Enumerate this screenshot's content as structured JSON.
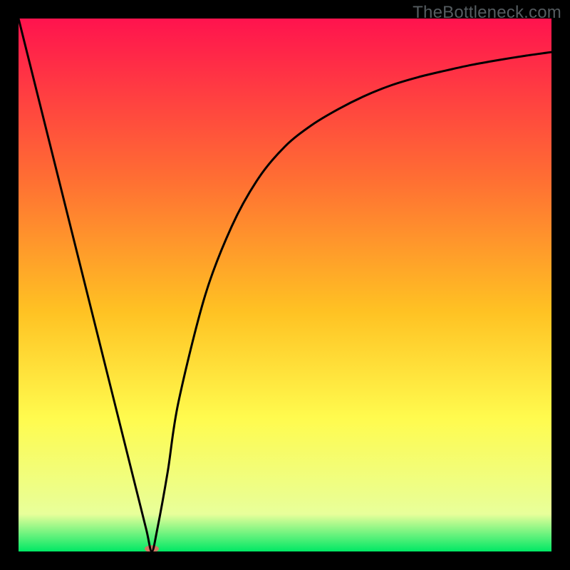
{
  "watermark": "TheBottleneck.com",
  "chart_data": {
    "type": "line",
    "title": "",
    "xlabel": "",
    "ylabel": "",
    "xlim": [
      0,
      100
    ],
    "ylim": [
      0,
      100
    ],
    "gradient_stops": [
      {
        "offset": 0,
        "color": "#ff134e"
      },
      {
        "offset": 30,
        "color": "#ff6e33"
      },
      {
        "offset": 55,
        "color": "#ffc223"
      },
      {
        "offset": 75,
        "color": "#fffb4e"
      },
      {
        "offset": 93,
        "color": "#e8ff9a"
      },
      {
        "offset": 100,
        "color": "#00e865"
      }
    ],
    "series": [
      {
        "name": "bottleneck-curve",
        "x": [
          0,
          5,
          10,
          15,
          20,
          22,
          24,
          25,
          26,
          28,
          30,
          35,
          40,
          45,
          50,
          55,
          60,
          65,
          70,
          75,
          80,
          85,
          90,
          95,
          100
        ],
        "values": [
          100,
          80,
          60,
          40,
          20,
          12,
          4,
          0,
          4,
          15,
          28,
          48,
          61,
          70,
          76,
          80,
          83,
          85.5,
          87.5,
          89,
          90.2,
          91.3,
          92.2,
          93,
          93.7
        ]
      }
    ],
    "markers": [
      {
        "name": "min-marker",
        "x": 25,
        "y": 0.5,
        "color": "#d07664",
        "rx": 10,
        "ry": 5
      }
    ]
  }
}
